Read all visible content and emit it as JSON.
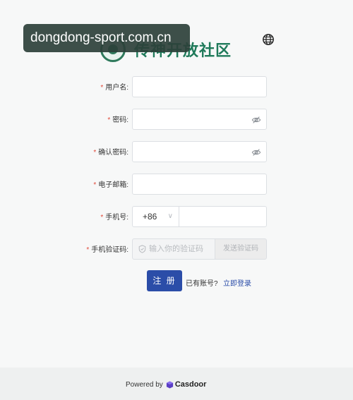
{
  "header": {
    "watermark": "dongdong-sport.com.cn",
    "logo_text": "传神开放社区",
    "language_icon": "globe-icon"
  },
  "form": {
    "username": {
      "label": "用户名:",
      "value": ""
    },
    "password": {
      "label": "密码:",
      "value": "",
      "icon": "eye-off-icon"
    },
    "confirm_password": {
      "label": "确认密码:",
      "value": "",
      "icon": "eye-off-icon"
    },
    "email": {
      "label": "电子邮箱:",
      "value": ""
    },
    "phone": {
      "label": "手机号:",
      "country_code": "+86",
      "value": ""
    },
    "phone_code": {
      "label": "手机验证码:",
      "placeholder": "输入你的验证码",
      "send_label": "发送验证码",
      "icon": "shield-icon"
    },
    "required_mark": "*",
    "submit_label": "注 册",
    "have_account_text": "已有账号?",
    "login_link": "立即登录"
  },
  "footer": {
    "powered_by": "Powered by",
    "brand": "Casdoor"
  },
  "colors": {
    "primary": "#2b4da8",
    "brand_green": "#1f7a5a",
    "required": "#e04a3a"
  }
}
